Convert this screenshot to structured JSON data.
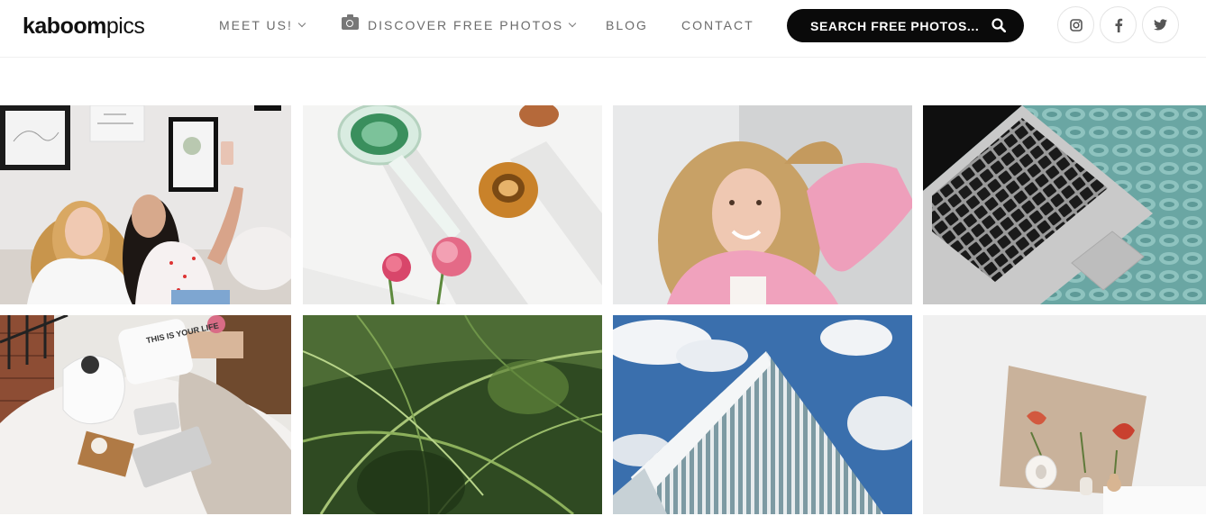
{
  "logo": {
    "bold": "kaboom",
    "light": "pics"
  },
  "nav": {
    "meet_us": "MEET US!",
    "discover": "DISCOVER FREE PHOTOS",
    "blog": "BLOG",
    "contact": "CONTACT"
  },
  "search": {
    "label": "SEARCH FREE PHOTOS...",
    "icon": "search-icon"
  },
  "social": [
    {
      "name": "instagram",
      "icon": "instagram-icon"
    },
    {
      "name": "facebook",
      "icon": "facebook-icon"
    },
    {
      "name": "twitter",
      "icon": "twitter-icon"
    }
  ],
  "gallery": [
    {
      "subject": "two-girls-selfie",
      "poster_text": ""
    },
    {
      "subject": "glasses-and-carnations",
      "poster_text": ""
    },
    {
      "subject": "smiling-blonde-woman",
      "poster_text": ""
    },
    {
      "subject": "laptop-on-knitted-mat",
      "poster_text": ""
    },
    {
      "subject": "bed-with-laptop",
      "pillow_text": "THIS IS YOUR LIFE"
    },
    {
      "subject": "palm-leaves",
      "poster_text": ""
    },
    {
      "subject": "building-and-sky",
      "poster_text": ""
    },
    {
      "subject": "vases-with-anthurium",
      "poster_text": ""
    }
  ],
  "colors": {
    "accent": "#0a0a0a",
    "nav_text": "#6b6b6b"
  }
}
